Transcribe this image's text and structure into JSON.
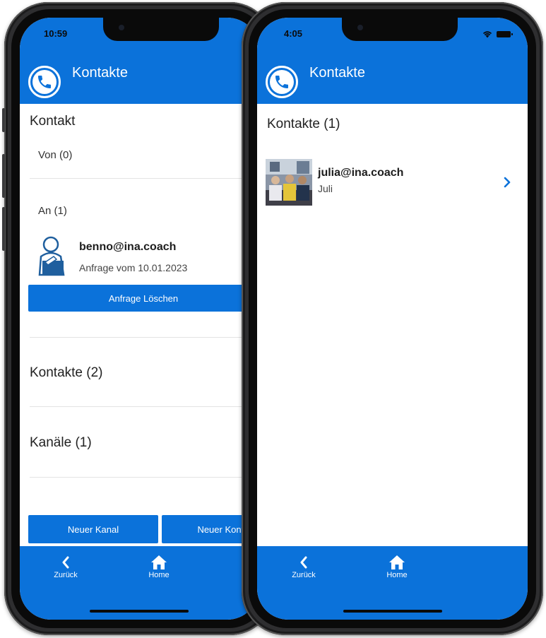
{
  "left_screen": {
    "status_time": "10:59",
    "header_title": "Kontakte",
    "section_kontakt": "Kontakt",
    "von_label": "Von (0)",
    "an_label": "An (1)",
    "request": {
      "name": "benno@ina.coach",
      "subtitle": "Anfrage vom 10.01.2023",
      "delete_label": "Anfrage Löschen"
    },
    "section_kontakte": "Kontakte (2)",
    "section_kanaele": "Kanäle (1)",
    "btn_new_channel": "Neuer Kanal",
    "btn_new_contact": "Neuer Kontakt",
    "nav": {
      "back": "Zurück",
      "home": "Home"
    }
  },
  "right_screen": {
    "status_time": "4:05",
    "header_title": "Kontakte",
    "section_title": "Kontakte (1)",
    "contact": {
      "name": "julia@ina.coach",
      "subtitle": "Juli"
    },
    "nav": {
      "back": "Zurück",
      "home": "Home"
    }
  },
  "colors": {
    "brand_blue": "#0b72da",
    "divider": "#e3e3e3",
    "icon_blue": "#1f5f9e"
  },
  "icons": [
    "phone-icon",
    "user-icon",
    "chevron-right-icon",
    "chevron-left-icon",
    "home-icon",
    "wifi-icon",
    "battery-icon"
  ]
}
